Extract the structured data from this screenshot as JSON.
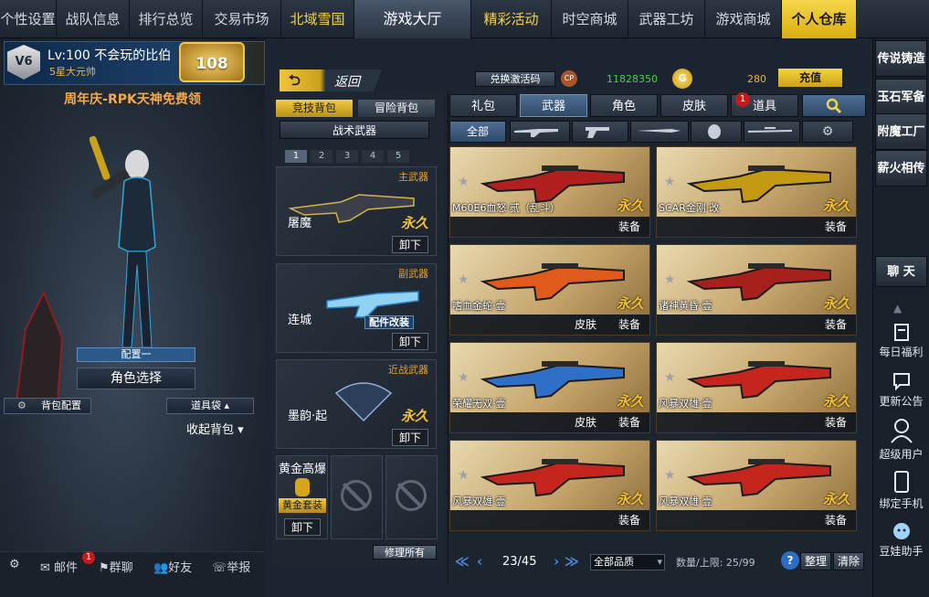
{
  "nav": [
    {
      "label": "个性设置",
      "style": "normal",
      "w": 62
    },
    {
      "label": "战队信息",
      "style": "normal",
      "w": 80
    },
    {
      "label": "排行总览",
      "style": "normal",
      "w": 80
    },
    {
      "label": "交易市场",
      "style": "normal",
      "w": 86
    },
    {
      "label": "北域雪国",
      "style": "gold",
      "w": 80
    },
    {
      "label": "游戏大厅",
      "style": "lobby",
      "w": 128
    },
    {
      "label": "精彩活动",
      "style": "gold",
      "w": 88
    },
    {
      "label": "时空商城",
      "style": "normal",
      "w": 84
    },
    {
      "label": "武器工坊",
      "style": "normal",
      "w": 84
    },
    {
      "label": "游戏商城",
      "style": "normal",
      "w": 84
    },
    {
      "label": "个人仓库",
      "style": "active",
      "w": 82
    }
  ],
  "profile": {
    "rank_label": "V6",
    "level_name": "Lv:100 不会玩的比伯",
    "title": "5星大元帅",
    "vip_level": "108"
  },
  "banner": "周年庆-RPK天神免费领",
  "left": {
    "preset": "配置一",
    "role_select": "角色选择",
    "backpack_config": "背包配置",
    "item_bag": "道具袋",
    "collapse_bag": "收起背包"
  },
  "bottom": {
    "mail": "邮件",
    "mail_badge": "1",
    "group_chat": "群聊",
    "friends": "好友",
    "report": "举报"
  },
  "mid": {
    "back_label": "返回",
    "tabs": [
      "竞技背包",
      "冒险背包"
    ],
    "section": "战术武器",
    "pages": [
      "1",
      "2",
      "3",
      "4",
      "5"
    ],
    "slots": [
      {
        "category": "主武器",
        "name": "屠魔",
        "perm": "永久",
        "action": "卸下"
      },
      {
        "category": "副武器",
        "name": "连城",
        "perm": "",
        "action": "卸下",
        "badge": "配件改装"
      },
      {
        "category": "近战武器",
        "name": "墨韵·起",
        "perm": "永久",
        "action": "卸下"
      }
    ],
    "grenade": {
      "name": "黄金高爆",
      "tag": "黄金套装",
      "action": "卸下"
    },
    "repair_all": "修理所有"
  },
  "currency": {
    "redeem": "兑换激活码",
    "cp_icon": "CP",
    "points": "11828350",
    "gold_icon": "G",
    "gold": "280",
    "recharge": "充值"
  },
  "tabs": [
    "礼包",
    "武器",
    "角色",
    "皮肤",
    "道具"
  ],
  "tab_badge": "1",
  "subtabs": {
    "all": "全部"
  },
  "cards": [
    {
      "name": "M60E6血怒·贰（乱斗）",
      "perm": "永久",
      "equip": "装备",
      "skin": "",
      "color": "#b21f1f"
    },
    {
      "name": "SCAR金刚·改",
      "perm": "永久",
      "equip": "装备",
      "skin": "",
      "color": "#c49a12"
    },
    {
      "name": "嗜血金蛇·壹",
      "perm": "永久",
      "equip": "装备",
      "skin": "皮肤",
      "color": "#e05a1c"
    },
    {
      "name": "诸神黄昏·壹",
      "perm": "永久",
      "equip": "装备",
      "skin": "",
      "color": "#a8201c"
    },
    {
      "name": "荣耀无双·壹",
      "perm": "永久",
      "equip": "装备",
      "skin": "皮肤",
      "color": "#2e6fc7"
    },
    {
      "name": "风暴双雄·壹",
      "perm": "永久",
      "equip": "装备",
      "skin": "",
      "color": "#c4261e"
    },
    {
      "name": "风暴双雄·壹",
      "perm": "永久",
      "equip": "装备",
      "skin": "",
      "color": "#c4261e"
    },
    {
      "name": "风暴双雄·壹",
      "perm": "永久",
      "equip": "装备",
      "skin": "",
      "color": "#c4261e"
    }
  ],
  "pager": {
    "page": "23/45",
    "quality": "全部品质",
    "limit": "数量/上限: 25/99",
    "sort": "整理",
    "clear": "清除"
  },
  "side": {
    "buttons": [
      "传说铸造",
      "玉石军备",
      "附魔工厂",
      "薪火相传"
    ],
    "chat": "聊 天",
    "services": [
      "每日福利",
      "更新公告",
      "超级用户",
      "绑定手机",
      "豆娃助手"
    ]
  }
}
